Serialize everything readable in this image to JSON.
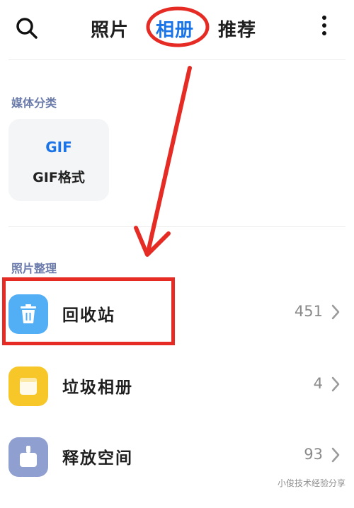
{
  "top_bar": {
    "search_icon": "search-icon",
    "tabs": [
      {
        "label": "照片",
        "active": false
      },
      {
        "label": "相册",
        "active": true
      },
      {
        "label": "推荐",
        "active": false
      }
    ],
    "more_icon": "more-vertical-icon",
    "active_color": "#1a74e8"
  },
  "media": {
    "section_label": "媒体分类",
    "gif_card": {
      "badge": "GIF",
      "label": "GIF格式"
    }
  },
  "organize": {
    "section_label": "照片整理",
    "items": [
      {
        "label": "回收站",
        "count": "451",
        "icon": "trash-icon",
        "color": "#52aef5"
      },
      {
        "label": "垃圾相册",
        "count": "4",
        "icon": "folder-icon",
        "color": "#f7c628"
      },
      {
        "label": "释放空间",
        "count": "93",
        "icon": "cleanup-icon",
        "color": "#8e9fd0"
      }
    ]
  },
  "annotation_color": "#e62b25",
  "watermark": "小俊技术经验分享"
}
